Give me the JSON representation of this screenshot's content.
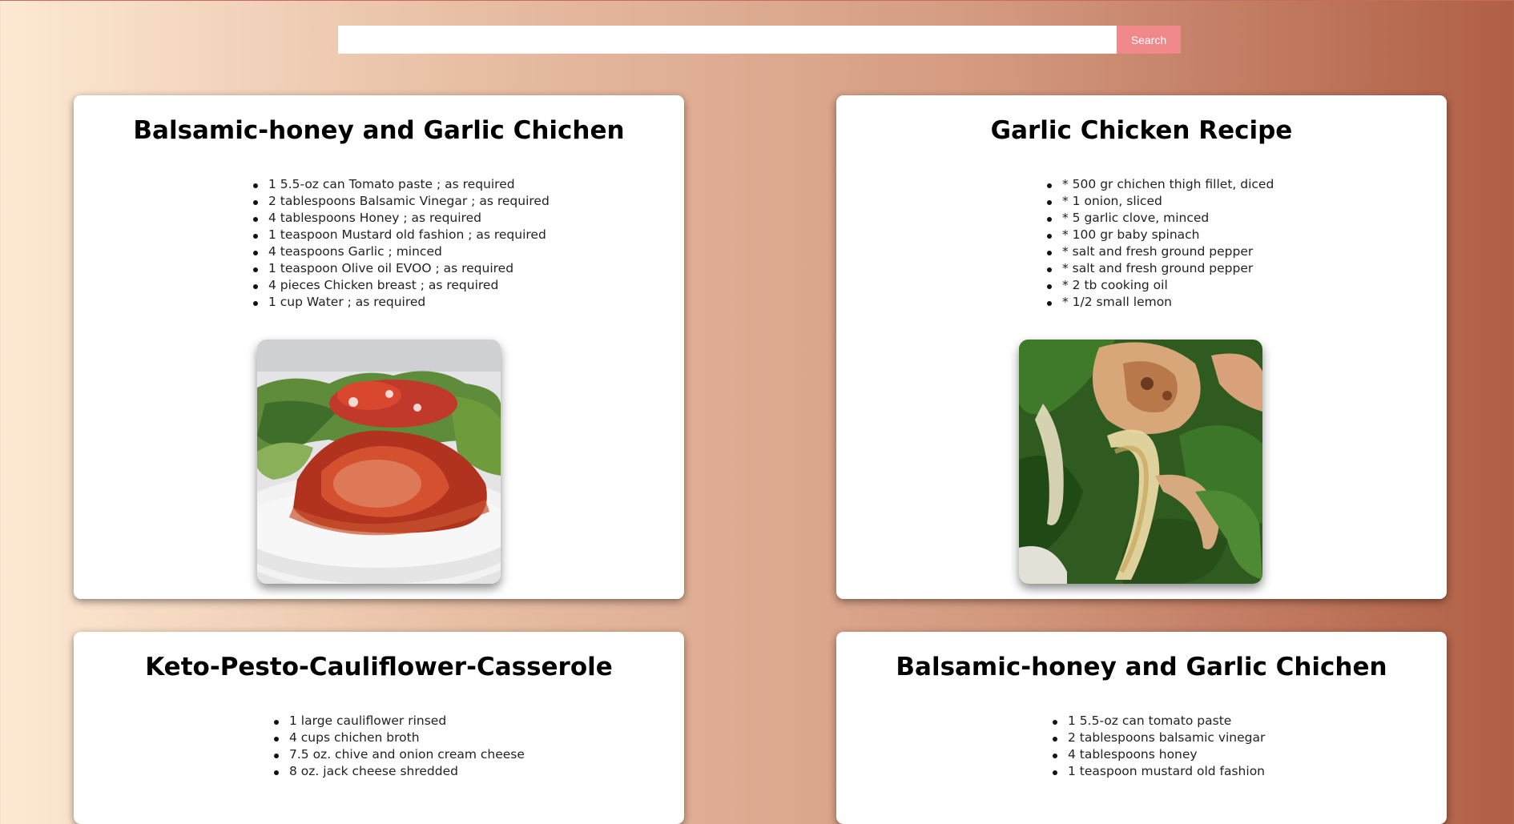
{
  "search": {
    "placeholder": "",
    "value": "",
    "button_label": "Search"
  },
  "colors": {
    "accent": "#f08a8a",
    "card_bg": "#ffffff",
    "gradient_start": "#fde9d3",
    "gradient_end": "#b05f45"
  },
  "recipes": [
    {
      "title": "Balsamic-honey and Garlic Chichen",
      "ingredients": [
        "1 5.5-oz can Tomato paste ; as required",
        "2 tablespoons Balsamic Vinegar ; as required",
        "4 tablespoons Honey ; as required",
        "1 teaspoon Mustard old fashion ; as required",
        "4 teaspoons Garlic ; minced",
        "1 teaspoon Olive oil EVOO ; as required",
        "4 pieces Chicken breast ; as required",
        "1 cup Water ; as required"
      ],
      "image_icon": "photo-chicken-tomato-sauce"
    },
    {
      "title": "Garlic Chicken Recipe",
      "ingredients": [
        "* 500 gr chichen thigh fillet, diced",
        "* 1 onion, sliced",
        "* 5 garlic clove, minced",
        "* 100 gr baby spinach",
        "* salt and fresh ground pepper",
        "* salt and fresh ground pepper",
        "* 2 tb cooking oil",
        "* 1/2 small lemon"
      ],
      "image_icon": "photo-chicken-spinach-onion"
    },
    {
      "title": "Keto-Pesto-Cauliflower-Casserole",
      "ingredients": [
        "1 large cauliflower rinsed",
        "4 cups chichen broth",
        "7.5 oz. chive and onion cream cheese",
        "8 oz. jack cheese shredded"
      ]
    },
    {
      "title": "Balsamic-honey and Garlic Chichen",
      "ingredients": [
        "1 5.5-oz can tomato paste",
        "2 tablespoons balsamic vinegar",
        "4 tablespoons honey",
        "1 teaspoon mustard old fashion"
      ]
    }
  ]
}
